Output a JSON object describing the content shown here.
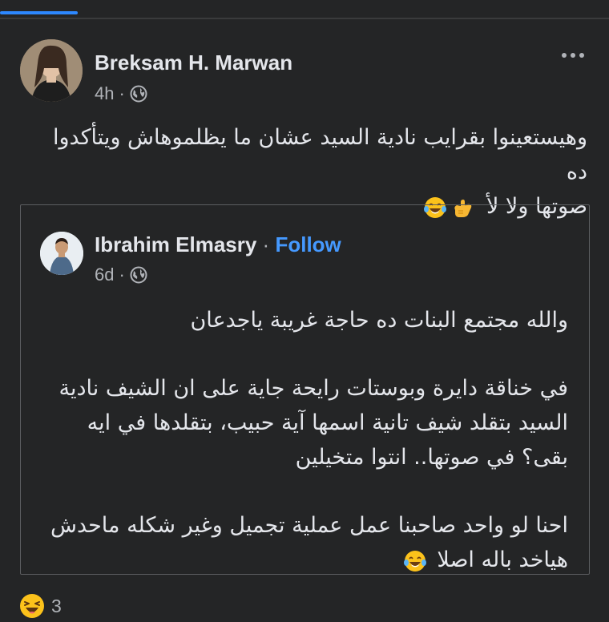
{
  "post": {
    "author": "Breksam H. Marwan",
    "time": "4h",
    "separator": "·",
    "privacy_icon": "globe-icon",
    "text_line_1": "وهيستعينوا بقرايب نادية السيد عشان ما يظلموهاش ويتأكدوا ده",
    "text_line_2": "صوتها ولا لأ",
    "text_emojis": [
      "call-me-hand-emoji",
      "tears-of-joy-emoji"
    ]
  },
  "shared": {
    "author": "Ibrahim Elmasry",
    "separator": "·",
    "follow_label": "Follow",
    "time": "6d",
    "privacy_icon": "globe-icon",
    "paragraphs": [
      "والله مجتمع البنات ده حاجة غريبة ياجدعان",
      "في خناقة دايرة وبوستات رايحة جاية على ان الشيف نادية السيد بتقلد شيف تانية اسمها آية حبيب، بتقلدها في ايه بقى؟ في صوتها.. انتوا متخيلين",
      "احنا لو واحد صاحبنا عمل عملية تجميل وغير شكله ماحدش هياخد باله اصلا"
    ],
    "last_emoji": "tears-of-joy-emoji"
  },
  "reactions": {
    "icon": "haha-reaction-icon",
    "count": "3"
  },
  "colors": {
    "background": "#242526",
    "text": "#e4e6eb",
    "secondary": "#b0b3b8",
    "link": "#4599ff",
    "accent": "#2d88ff"
  }
}
